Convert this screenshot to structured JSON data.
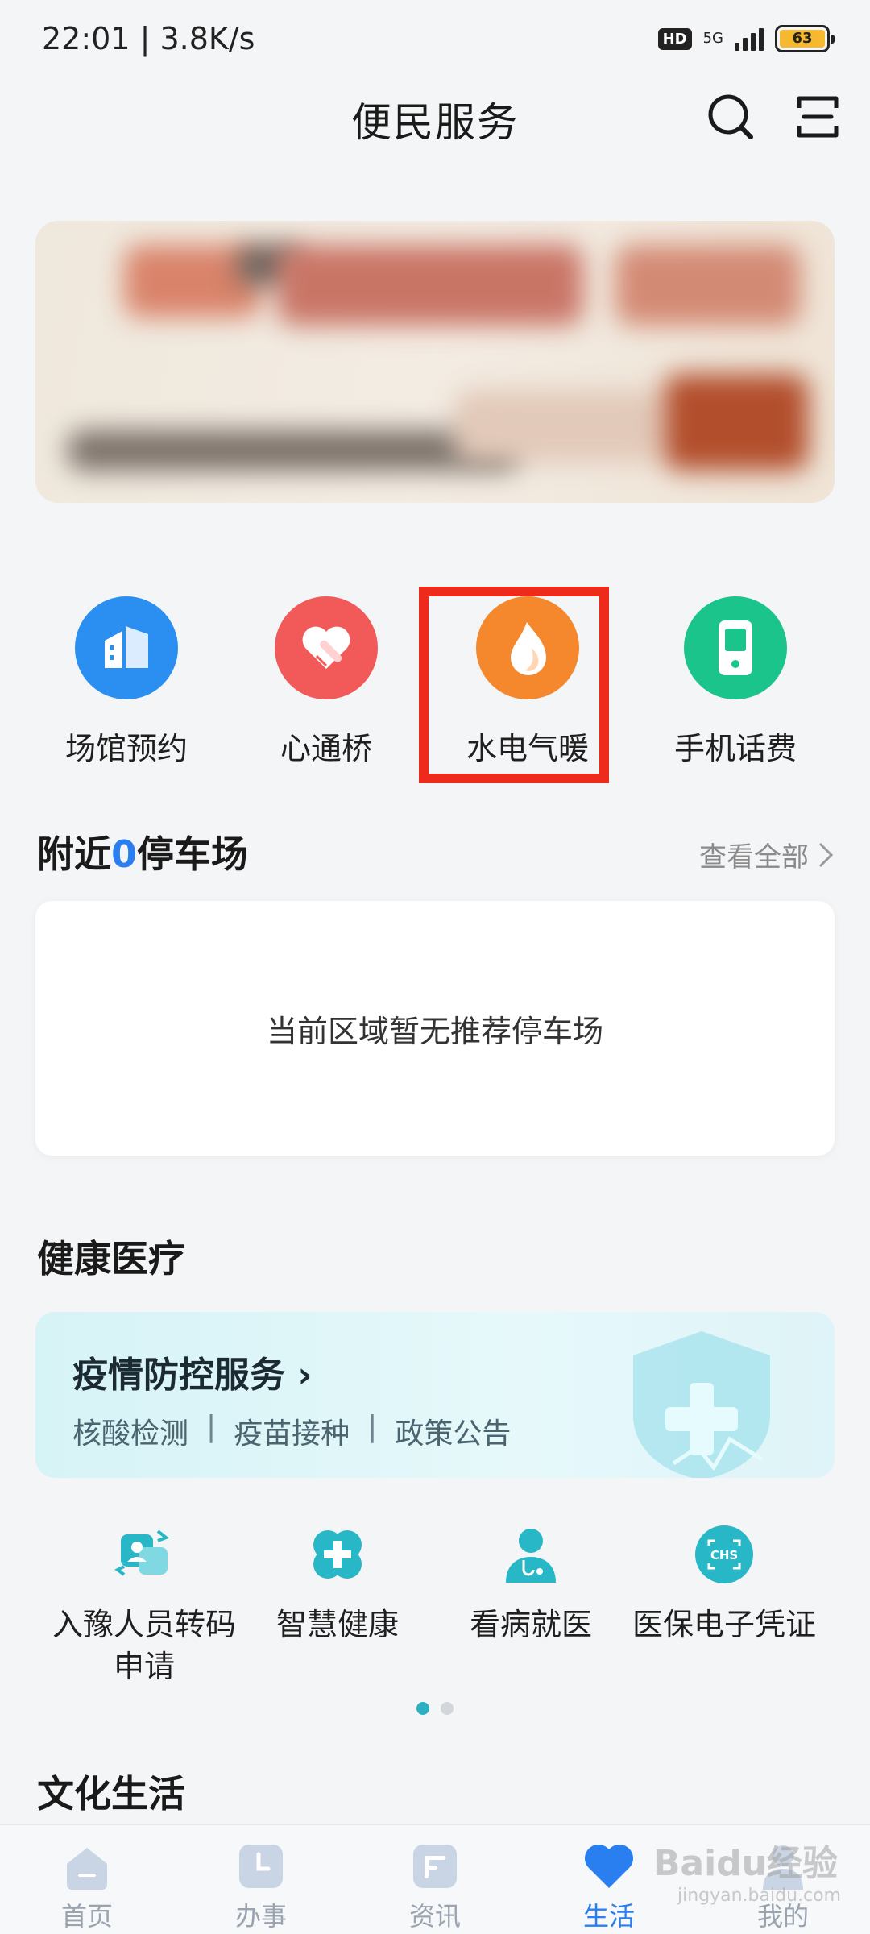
{
  "status_bar": {
    "time": "22:01",
    "speed": "3.8K/s",
    "hd": "HD",
    "network": "5G",
    "battery": "63"
  },
  "header": {
    "title": "便民服务"
  },
  "services": [
    {
      "label": "场馆预约",
      "icon": "building-icon",
      "color": "#2a8ff0"
    },
    {
      "label": "心通桥",
      "icon": "heart-bandage-icon",
      "color": "#f25a5a"
    },
    {
      "label": "水电气暖",
      "icon": "flame-icon",
      "color": "#f5872c"
    },
    {
      "label": "手机话费",
      "icon": "phone-icon",
      "color": "#1bc48a"
    }
  ],
  "parking": {
    "prefix": "附近",
    "count": "0",
    "suffix": "停车场",
    "see_all": "查看全部",
    "empty_text": "当前区域暂无推荐停车场"
  },
  "health": {
    "title": "健康医疗",
    "card_title": "疫情防控服务",
    "links": [
      "核酸检测",
      "疫苗接种",
      "政策公告"
    ],
    "items": [
      {
        "label_line1": "入豫人员转码",
        "label_line2": "申请",
        "icon": "transfer-code-icon"
      },
      {
        "label_line1": "智慧健康",
        "label_line2": "",
        "icon": "medical-cross-icon"
      },
      {
        "label_line1": "看病就医",
        "label_line2": "",
        "icon": "doctor-icon"
      },
      {
        "label_line1": "医保电子凭证",
        "label_line2": "",
        "icon": "chs-icon"
      }
    ]
  },
  "culture": {
    "title": "文化生活"
  },
  "tab_bar": {
    "tabs": [
      {
        "label": "首页",
        "icon": "home-icon"
      },
      {
        "label": "办事",
        "icon": "clock-icon"
      },
      {
        "label": "资讯",
        "icon": "news-icon"
      },
      {
        "label": "生活",
        "icon": "heart-icon"
      },
      {
        "label": "我的",
        "icon": "user-icon"
      }
    ],
    "active_index": 3
  },
  "watermark": {
    "text": "Baidu经验",
    "sub": "jingyan.baidu.com"
  },
  "colors": {
    "accent": "#2a7ff0",
    "highlight": "#ee2a1c"
  }
}
